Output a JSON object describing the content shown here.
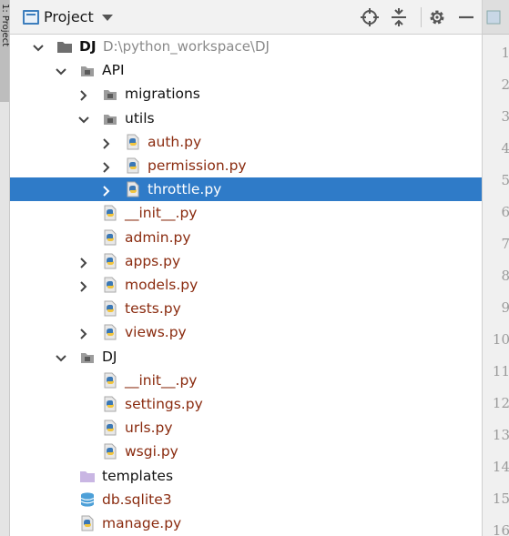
{
  "side_tab": {
    "label": "1: Project"
  },
  "header": {
    "title": "Project"
  },
  "tree": [
    {
      "label": "DJ",
      "path": "D:\\python_workspace\\DJ",
      "kind": "root",
      "depth": 0,
      "arrow": "down",
      "icon": "folder-dark"
    },
    {
      "label": "API",
      "kind": "folder",
      "depth": 1,
      "arrow": "down",
      "icon": "folder-small"
    },
    {
      "label": "migrations",
      "kind": "folder",
      "depth": 2,
      "arrow": "right",
      "icon": "folder-small"
    },
    {
      "label": "utils",
      "kind": "folder",
      "depth": 2,
      "arrow": "down",
      "icon": "folder-small"
    },
    {
      "label": "auth.py",
      "kind": "file",
      "depth": 3,
      "arrow": "right",
      "icon": "python"
    },
    {
      "label": "permission.py",
      "kind": "file",
      "depth": 3,
      "arrow": "right",
      "icon": "python"
    },
    {
      "label": "throttle.py",
      "kind": "file",
      "depth": 3,
      "arrow": "right",
      "icon": "python",
      "selected": true
    },
    {
      "label": "__init__.py",
      "kind": "file",
      "depth": 2,
      "arrow": "none",
      "icon": "python"
    },
    {
      "label": "admin.py",
      "kind": "file",
      "depth": 2,
      "arrow": "none",
      "icon": "python"
    },
    {
      "label": "apps.py",
      "kind": "file",
      "depth": 2,
      "arrow": "right",
      "icon": "python"
    },
    {
      "label": "models.py",
      "kind": "file",
      "depth": 2,
      "arrow": "right",
      "icon": "python"
    },
    {
      "label": "tests.py",
      "kind": "file",
      "depth": 2,
      "arrow": "none",
      "icon": "python"
    },
    {
      "label": "views.py",
      "kind": "file",
      "depth": 2,
      "arrow": "right",
      "icon": "python"
    },
    {
      "label": "DJ",
      "kind": "folder",
      "depth": 1,
      "arrow": "down",
      "icon": "folder-small"
    },
    {
      "label": "__init__.py",
      "kind": "file",
      "depth": 2,
      "arrow": "none",
      "icon": "python"
    },
    {
      "label": "settings.py",
      "kind": "file",
      "depth": 2,
      "arrow": "none",
      "icon": "python"
    },
    {
      "label": "urls.py",
      "kind": "file",
      "depth": 2,
      "arrow": "none",
      "icon": "python"
    },
    {
      "label": "wsgi.py",
      "kind": "file",
      "depth": 2,
      "arrow": "none",
      "icon": "python"
    },
    {
      "label": "templates",
      "kind": "folder",
      "depth": 1,
      "arrow": "none",
      "icon": "folder-purple"
    },
    {
      "label": "db.sqlite3",
      "kind": "file",
      "depth": 1,
      "arrow": "none",
      "icon": "database"
    },
    {
      "label": "manage.py",
      "kind": "file",
      "depth": 1,
      "arrow": "none",
      "icon": "python"
    }
  ],
  "line_numbers": [
    "1",
    "2",
    "3",
    "4",
    "5",
    "6",
    "7",
    "8",
    "9",
    "10",
    "11",
    "12",
    "13",
    "14",
    "15",
    "16"
  ],
  "colors": {
    "selection": "#2f7bc8",
    "file_text": "#8a2b0f",
    "path_text": "#8a8a8a"
  }
}
